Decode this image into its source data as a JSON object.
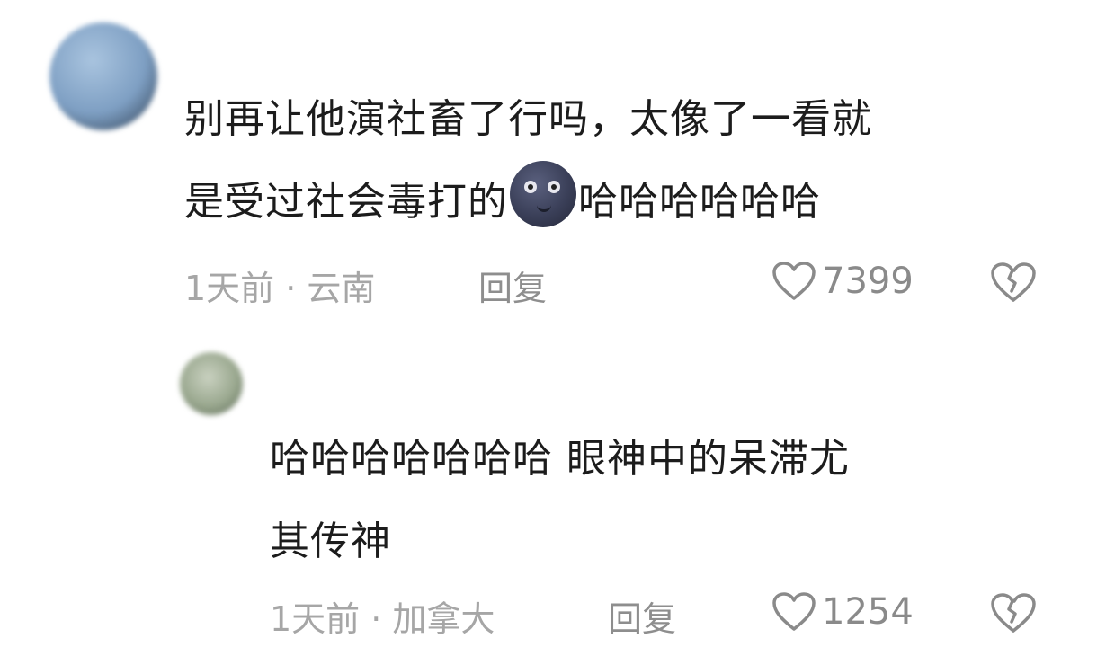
{
  "comments": [
    {
      "text_line1": "别再让他演社畜了行吗，太像了一看就",
      "text_line2_before_emoji": "是受过社会毒打的",
      "emoji": "moon-face-icon",
      "text_line2_after_emoji": "哈哈哈哈哈哈",
      "meta": "1天前 · 云南",
      "reply_label": "回复",
      "like_count": "7399"
    }
  ],
  "replies": [
    {
      "text_line1": "哈哈哈哈哈哈哈 眼神中的呆滞尤",
      "text_line2": "其传神",
      "meta": "1天前 · 加拿大",
      "reply_label": "回复",
      "like_count": "1254"
    }
  ],
  "colors": {
    "text": "#1c1c1c",
    "meta": "#a6a6a6",
    "icon": "#8a8a8a",
    "background": "#ffffff"
  }
}
